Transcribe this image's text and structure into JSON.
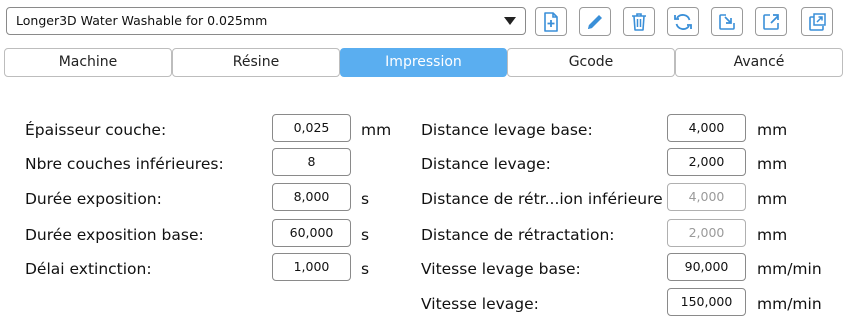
{
  "profile": {
    "selected": "Longer3D Water Washable for 0.025mm"
  },
  "toolbar": {
    "icons": [
      "add-file-icon",
      "edit-icon",
      "trash-icon",
      "refresh-icon",
      "import-icon",
      "export-icon",
      "export-all-icon"
    ],
    "accent": "#3a8fd8"
  },
  "tabs": [
    {
      "label": "Machine",
      "active": false
    },
    {
      "label": "Résine",
      "active": false
    },
    {
      "label": "Impression",
      "active": true
    },
    {
      "label": "Gcode",
      "active": false
    },
    {
      "label": "Avancé",
      "active": false
    }
  ],
  "colors": {
    "active_tab": "#5aaef0"
  },
  "left_fields": [
    {
      "label": "Épaisseur couche:",
      "value": "0,025",
      "unit": "mm"
    },
    {
      "label": "Nbre couches inférieures:",
      "value": "8",
      "unit": ""
    },
    {
      "label": "Durée exposition:",
      "value": "8,000",
      "unit": "s"
    },
    {
      "label": "Durée exposition base:",
      "value": "60,000",
      "unit": "s"
    },
    {
      "label": "Délai extinction:",
      "value": "1,000",
      "unit": "s"
    }
  ],
  "right_fields": [
    {
      "label": "Distance levage base:",
      "value": "4,000",
      "unit": "mm",
      "enabled": true
    },
    {
      "label": "Distance levage:",
      "value": "2,000",
      "unit": "mm",
      "enabled": true
    },
    {
      "label": "Distance de rétr...ion inférieure :",
      "value": "4,000",
      "unit": "mm",
      "enabled": false
    },
    {
      "label": "Distance de rétractation:",
      "value": "2,000",
      "unit": "mm",
      "enabled": false
    },
    {
      "label": "Vitesse levage base:",
      "value": "90,000",
      "unit": "mm/min",
      "enabled": true
    },
    {
      "label": "Vitesse levage:",
      "value": "150,000",
      "unit": "mm/min",
      "enabled": true
    }
  ]
}
